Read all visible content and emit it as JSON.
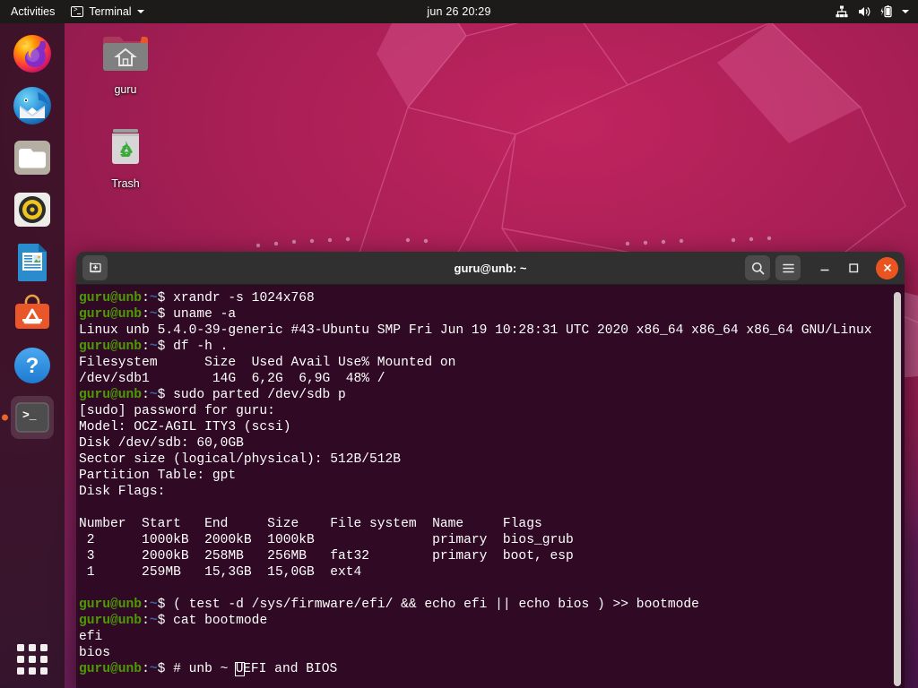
{
  "topbar": {
    "activities": "Activities",
    "app_name": "Terminal",
    "app_icon": "terminal-icon",
    "clock": "jun 26  20:29",
    "tray": [
      {
        "name": "network-wired-icon"
      },
      {
        "name": "volume-icon"
      },
      {
        "name": "battery-charging-icon"
      },
      {
        "name": "system-menu-caret-icon"
      }
    ]
  },
  "dock": {
    "items": [
      {
        "name": "firefox",
        "label": "Firefox",
        "active": false
      },
      {
        "name": "thunderbird",
        "label": "Thunderbird Mail",
        "active": false
      },
      {
        "name": "files",
        "label": "Files",
        "active": false
      },
      {
        "name": "rhythmbox",
        "label": "Rhythmbox",
        "active": false
      },
      {
        "name": "libreoffice-writer",
        "label": "LibreOffice Writer",
        "active": false
      },
      {
        "name": "ubuntu-software",
        "label": "Ubuntu Software",
        "active": false
      },
      {
        "name": "help",
        "label": "Help",
        "active": false
      },
      {
        "name": "terminal",
        "label": "Terminal",
        "active": true
      }
    ],
    "show_apps_label": "Show Applications"
  },
  "desktop_icons": [
    {
      "name": "home-folder",
      "label": "guru",
      "icon": "home-folder-icon"
    },
    {
      "name": "trash",
      "label": "Trash",
      "icon": "trash-icon"
    }
  ],
  "window": {
    "title": "guru@unb: ~",
    "new_tab_label": "New Tab",
    "search_label": "Search",
    "menu_label": "Menu",
    "minimize_label": "Minimize",
    "maximize_label": "Maximize",
    "close_label": "Close"
  },
  "terminal": {
    "prompt_user": "guru@unb",
    "prompt_colon": ":",
    "prompt_path": "~",
    "prompt_sigil": "$ ",
    "lines": [
      {
        "type": "prompt",
        "cmd": "xrandr -s 1024x768"
      },
      {
        "type": "prompt",
        "cmd": "uname -a"
      },
      {
        "type": "out",
        "text": "Linux unb 5.4.0-39-generic #43-Ubuntu SMP Fri Jun 19 10:28:31 UTC 2020 x86_64 x86_64 x86_64 GNU/Linux"
      },
      {
        "type": "prompt",
        "cmd": "df -h ."
      },
      {
        "type": "out",
        "text": "Filesystem      Size  Used Avail Use% Mounted on"
      },
      {
        "type": "out",
        "text": "/dev/sdb1        14G  6,2G  6,9G  48% /"
      },
      {
        "type": "prompt",
        "cmd": "sudo parted /dev/sdb p"
      },
      {
        "type": "out",
        "text": "[sudo] password for guru:"
      },
      {
        "type": "out",
        "text": "Model: OCZ-AGIL ITY3 (scsi)"
      },
      {
        "type": "out",
        "text": "Disk /dev/sdb: 60,0GB"
      },
      {
        "type": "out",
        "text": "Sector size (logical/physical): 512B/512B"
      },
      {
        "type": "out",
        "text": "Partition Table: gpt"
      },
      {
        "type": "out",
        "text": "Disk Flags:"
      },
      {
        "type": "out",
        "text": ""
      },
      {
        "type": "out",
        "text": "Number  Start   End     Size    File system  Name     Flags"
      },
      {
        "type": "out",
        "text": " 2      1000kB  2000kB  1000kB               primary  bios_grub"
      },
      {
        "type": "out",
        "text": " 3      2000kB  258MB   256MB   fat32        primary  boot, esp"
      },
      {
        "type": "out",
        "text": " 1      259MB   15,3GB  15,0GB  ext4"
      },
      {
        "type": "out",
        "text": ""
      },
      {
        "type": "prompt",
        "cmd": "( test -d /sys/firmware/efi/ && echo efi || echo bios ) >> bootmode"
      },
      {
        "type": "prompt",
        "cmd": "cat bootmode"
      },
      {
        "type": "out",
        "text": "efi"
      },
      {
        "type": "out",
        "text": "bios"
      },
      {
        "type": "prompt_cursor",
        "pre": "# unb ~ ",
        "cursor": "U",
        "post": "EFI and BIOS"
      }
    ],
    "colors": {
      "background": "#300a24",
      "foreground": "#ffffff",
      "prompt_user": "#4e9a06",
      "prompt_path": "#3465a4",
      "titlebar": "#303030",
      "close_button": "#e95420"
    },
    "parted_table": {
      "headers": [
        "Number",
        "Start",
        "End",
        "Size",
        "File system",
        "Name",
        "Flags"
      ],
      "rows": [
        [
          "2",
          "1000kB",
          "2000kB",
          "1000kB",
          "",
          "primary",
          "bios_grub"
        ],
        [
          "3",
          "2000kB",
          "258MB",
          "256MB",
          "fat32",
          "primary",
          "boot, esp"
        ],
        [
          "1",
          "259MB",
          "15,3GB",
          "15,0GB",
          "ext4",
          "",
          ""
        ]
      ]
    }
  }
}
